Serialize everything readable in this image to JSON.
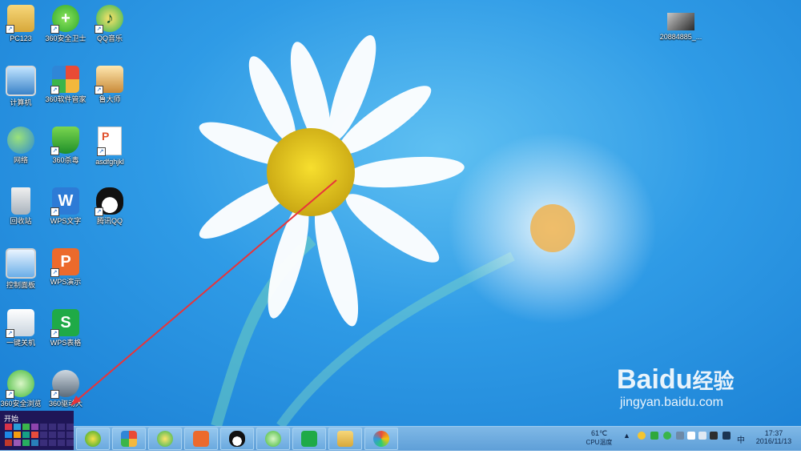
{
  "desktop_icons": [
    {
      "label": "PC123"
    },
    {
      "label": "360安全卫士"
    },
    {
      "label": "QQ音乐"
    },
    {
      "label": "计算机"
    },
    {
      "label": "360软件管家"
    },
    {
      "label": "鲁大师"
    },
    {
      "label": "网络"
    },
    {
      "label": "360杀毒"
    },
    {
      "label": "asdfghjkl"
    },
    {
      "label": "回收站"
    },
    {
      "label": "WPS文字"
    },
    {
      "label": "腾讯QQ"
    },
    {
      "label": "控制面板"
    },
    {
      "label": "WPS演示"
    },
    {
      "label": "一键关机"
    },
    {
      "label": "WPS表格"
    },
    {
      "label": "360安全浏览"
    },
    {
      "label": "360驱动大"
    },
    {
      "label": "20884885_..."
    }
  ],
  "start_menu": {
    "title": "开始"
  },
  "taskbar": {
    "apps": [
      "360-safe-icon",
      "360-software-icon",
      "qq-music-icon",
      "wps-presentation-icon",
      "qq-penguin-icon",
      "360-browser-icon",
      "wps-spreadsheet-icon",
      "file-explorer-icon",
      "paint-icon"
    ]
  },
  "tray": {
    "temperature": "61℃",
    "temperature_label": "CPU温度",
    "ime": "中",
    "time": "17:37",
    "date": "2016/11/13"
  },
  "watermark": {
    "brand": "Bai",
    "brand_suffix": "du",
    "jingyan": "经验",
    "url": "jingyan.baidu.com"
  },
  "colors": {
    "accent_arrow": "#e8343a",
    "start_bg": "#1f1657",
    "taskbar": "#6aa9df"
  }
}
